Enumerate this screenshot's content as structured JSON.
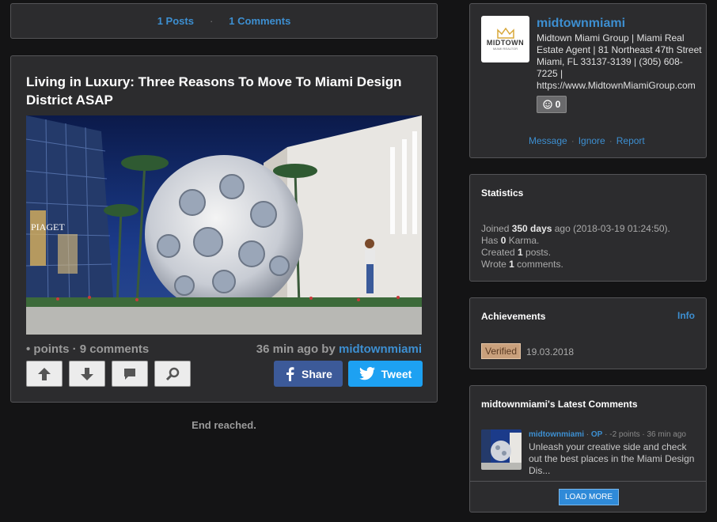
{
  "topbar": {
    "posts": "1 Posts",
    "separator": "·",
    "comments": "1 Comments"
  },
  "post": {
    "title": "Living in Luxury: Three Reasons To Move To Miami Design District ASAP",
    "image_icon": "photo-of-miami-design-district-dome",
    "meta_left": "• points · 9 comments",
    "meta_time": "36 min ago by ",
    "meta_user": "midtownmiami",
    "share_label": "Share",
    "tweet_label": "Tweet"
  },
  "end_reached": "End reached.",
  "profile": {
    "logo_text": "MIDTOWN",
    "logo_sub": "MIAMI REALTOR",
    "name": "midtownmiami",
    "bio": "Midtown Miami Group | Miami Real Estate Agent | 81 Northeast 47th Street Miami, FL 33137-3139 | (305) 608-7225 | https://www.MidtownMiamiGroup.com",
    "karma": "0",
    "actions": {
      "message": "Message",
      "ignore": "Ignore",
      "report": "Report",
      "sep": "·"
    }
  },
  "stats": {
    "title": "Statistics",
    "joined_pre": "Joined ",
    "joined_days": "350 days",
    "joined_post": " ago (2018-03-19 01:24:50).",
    "karma_pre": "Has ",
    "karma_val": "0",
    "karma_post": " Karma.",
    "posts_pre": "Created ",
    "posts_val": "1",
    "posts_post": " posts.",
    "comments_pre": "Wrote ",
    "comments_val": "1",
    "comments_post": " comments."
  },
  "achievements": {
    "title": "Achievements",
    "info": "Info",
    "badge": "Verified",
    "date": "19.03.2018"
  },
  "latest": {
    "title": "midtownmiami's Latest Comments",
    "user": "midtownmiami",
    "op": "OP",
    "points": "-2 points",
    "time": "36 min ago",
    "text": "Unleash your creative side and check out the best places in the Miami Design Dis...",
    "load_more": "LOAD MORE"
  },
  "colors": {
    "accent": "#3d8fd1",
    "facebook": "#3c5a99",
    "twitter": "#1da1f2",
    "panel": "#2c2c2e",
    "verified": "#c9a07c"
  }
}
